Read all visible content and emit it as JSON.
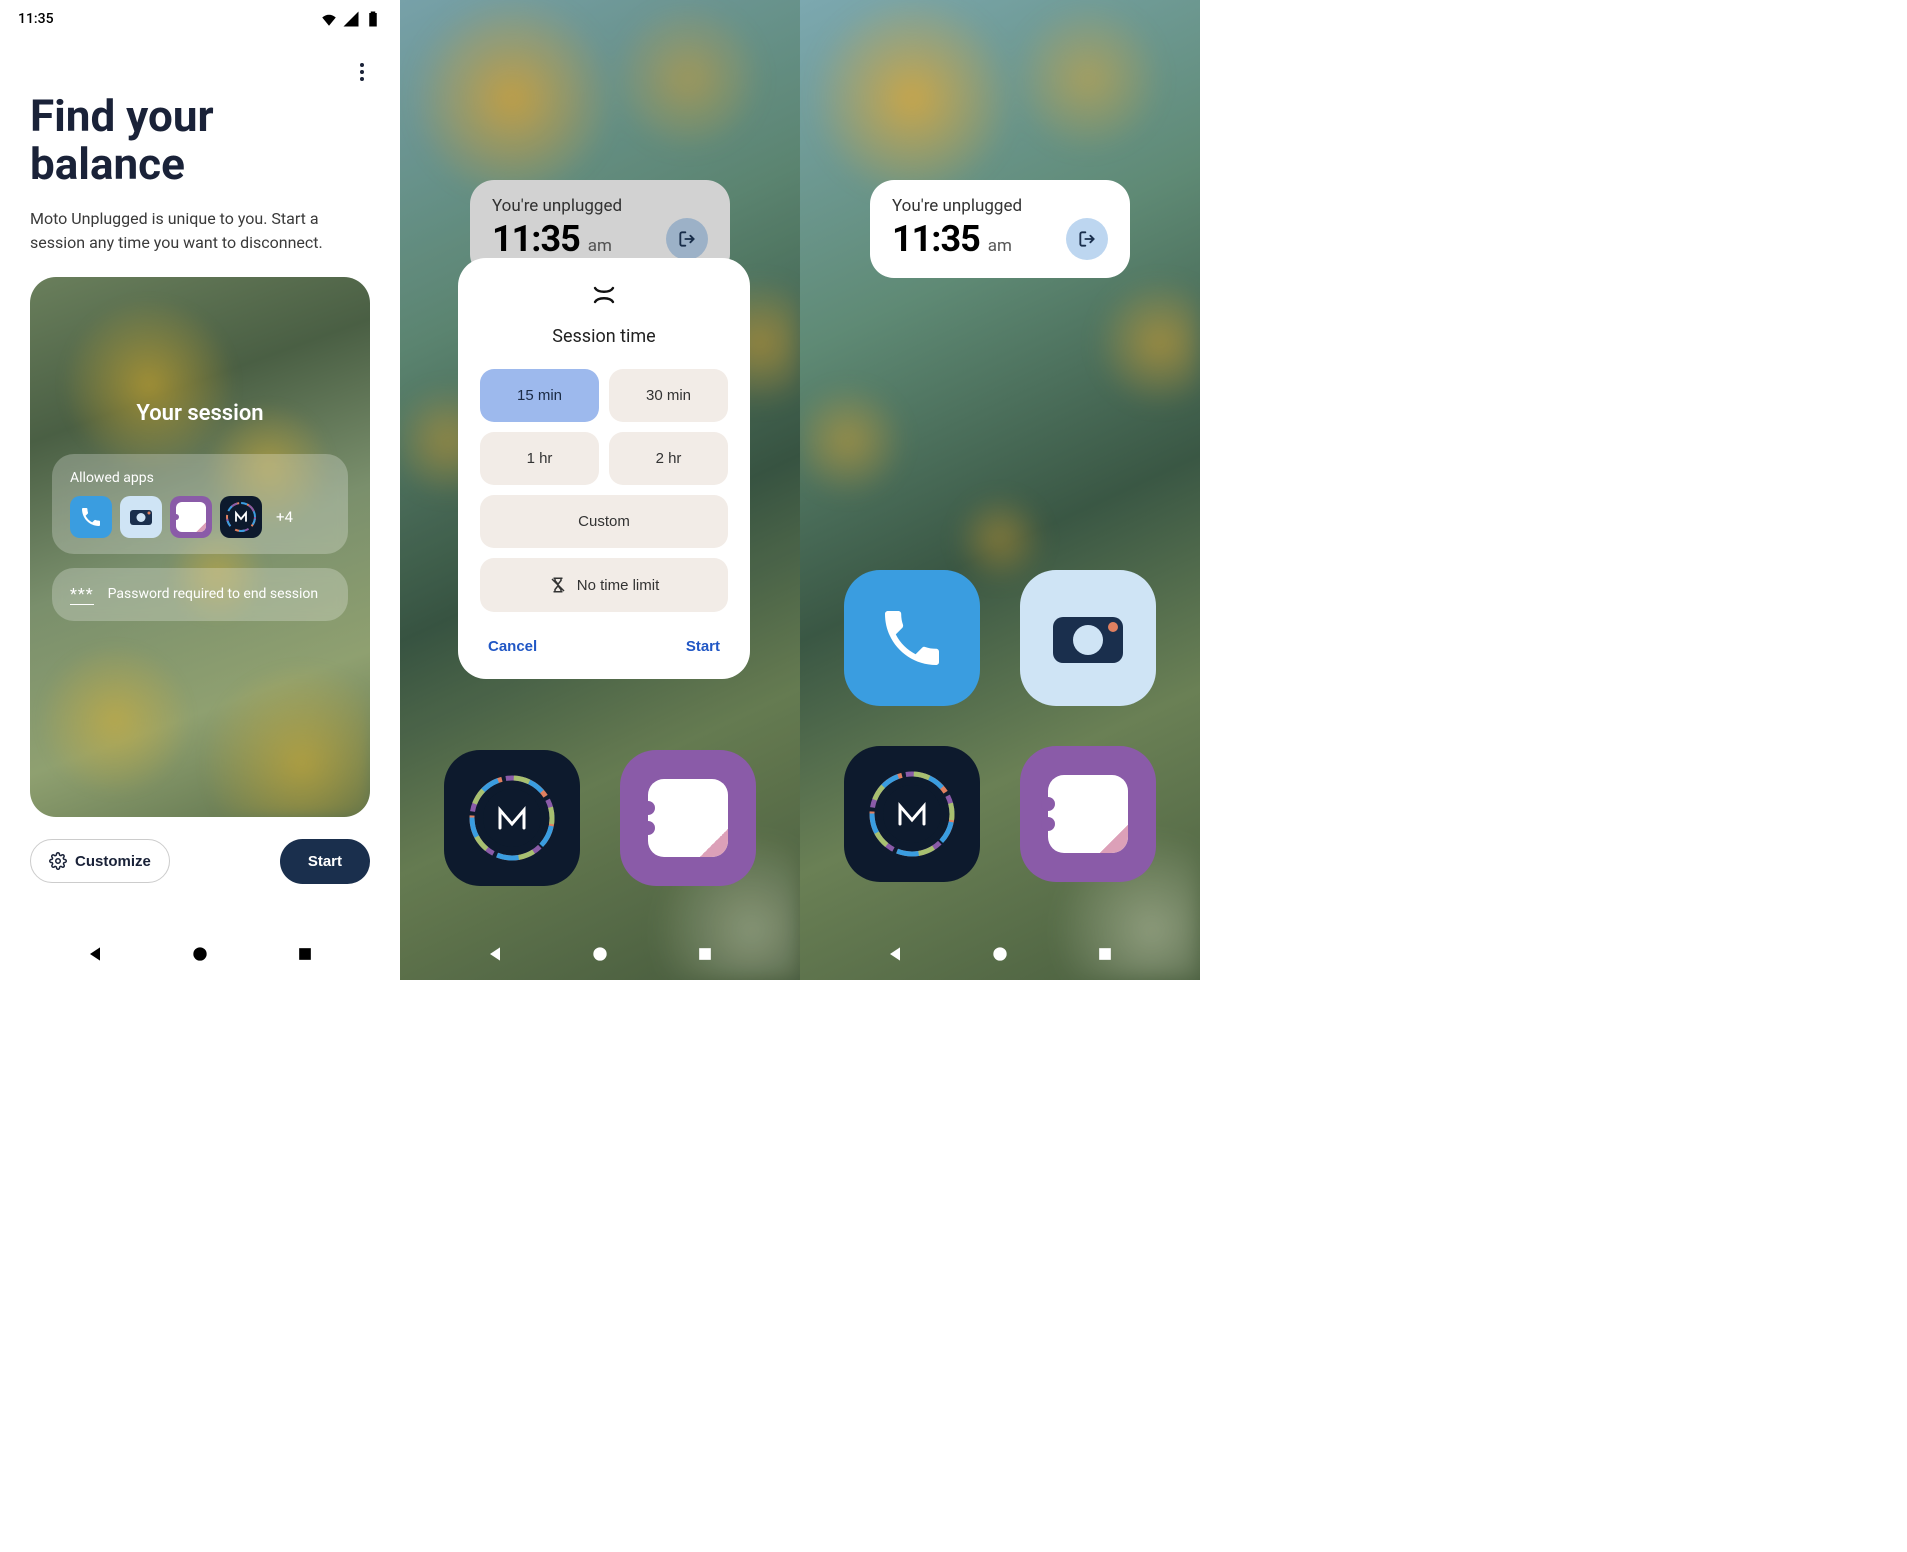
{
  "screen1": {
    "status_time": "11:35",
    "title_line1": "Find your",
    "title_line2": "balance",
    "subtitle": "Moto Unplugged is unique to you. Start a session any time you want to disconnect.",
    "session": {
      "heading": "Your session",
      "allowed_label": "Allowed apps",
      "apps": [
        "phone",
        "camera",
        "ticket",
        "moto"
      ],
      "plus": "+4",
      "password_text": "Password required to end session"
    },
    "buttons": {
      "customize": "Customize",
      "start": "Start"
    }
  },
  "screen2": {
    "unplugged": {
      "label": "You're unplugged",
      "time": "11:35",
      "ampm": "am"
    },
    "dialog": {
      "title": "Session time",
      "options": [
        "15 min",
        "30 min",
        "1 hr",
        "2 hr",
        "Custom",
        "No time limit"
      ],
      "cancel": "Cancel",
      "start": "Start"
    }
  },
  "screen3": {
    "unplugged": {
      "label": "You're unplugged",
      "time": "11:35",
      "ampm": "am"
    }
  }
}
